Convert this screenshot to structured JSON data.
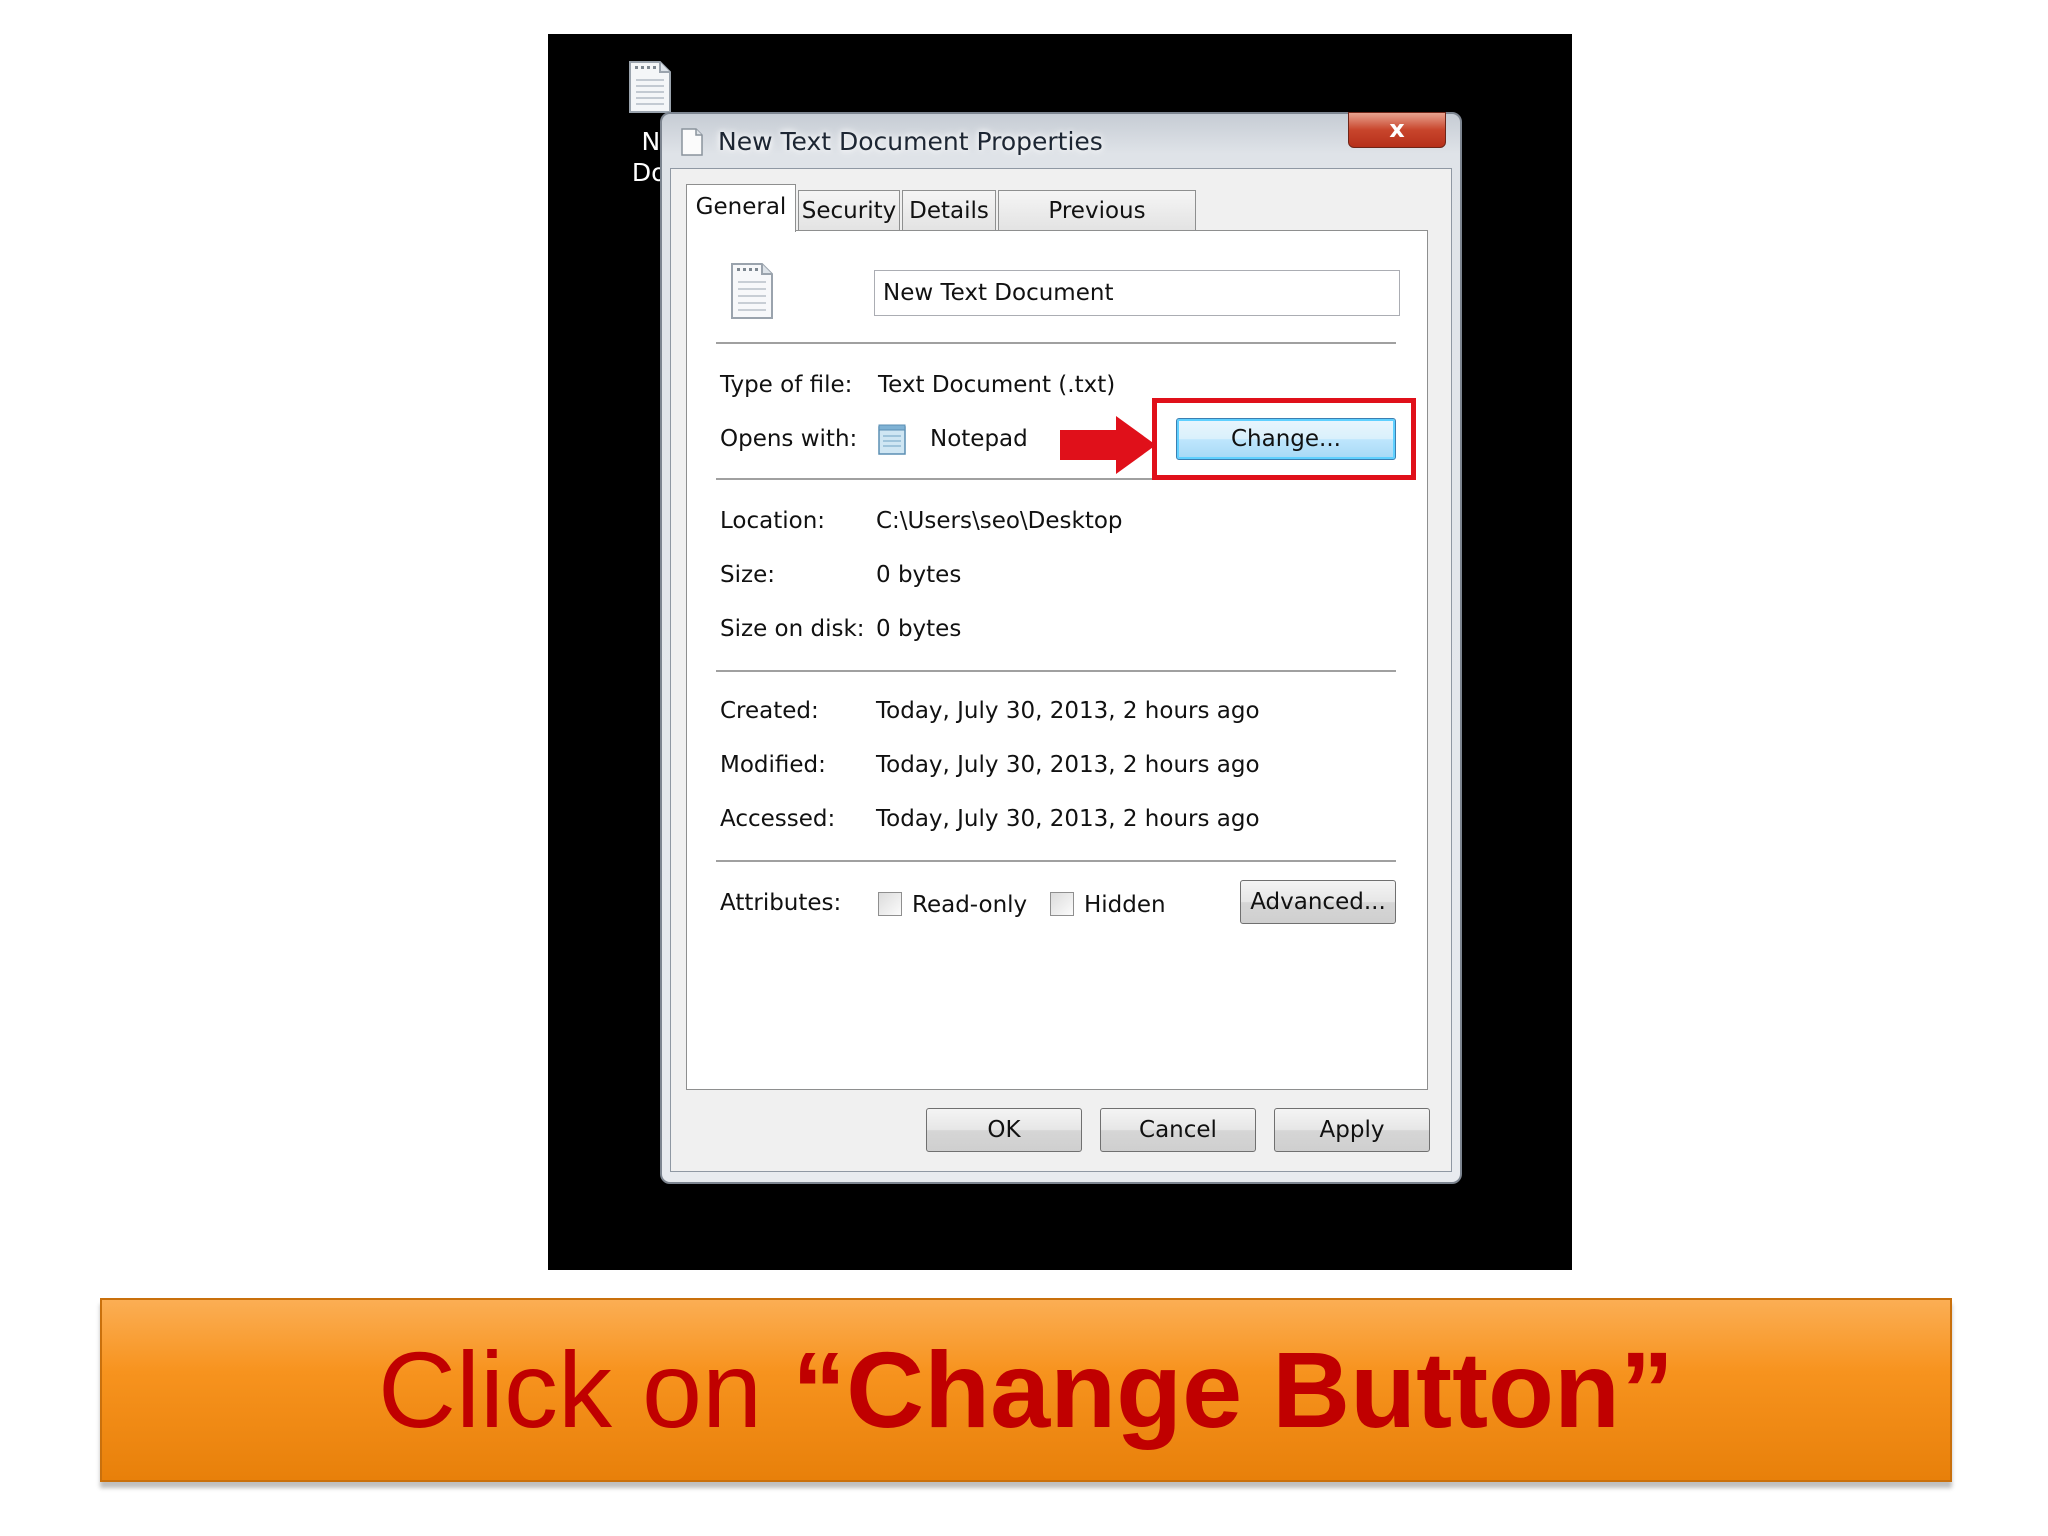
{
  "desktop": {
    "icon_name": "text-file-icon",
    "label": "New\nDocu"
  },
  "window": {
    "title": "New Text Document Properties",
    "close_label": "x",
    "icon_name": "text-file-icon"
  },
  "tabs": [
    {
      "label": "General",
      "active": true
    },
    {
      "label": "Security",
      "active": false
    },
    {
      "label": "Details",
      "active": false
    },
    {
      "label": "Previous Versions",
      "active": false
    }
  ],
  "general": {
    "file_name": "New Text Document",
    "type_label": "Type of file:",
    "type_value": "Text Document (.txt)",
    "opens_label": "Opens with:",
    "opens_value": "Notepad",
    "opens_icon": "notepad-icon",
    "change_label": "Change...",
    "location_label": "Location:",
    "location_value": "C:\\Users\\seo\\Desktop",
    "size_label": "Size:",
    "size_value": "0 bytes",
    "size_disk_label": "Size on disk:",
    "size_disk_value": "0 bytes",
    "created_label": "Created:",
    "created_value": "Today, July 30, 2013, 2 hours ago",
    "modified_label": "Modified:",
    "modified_value": "Today, July 30, 2013, 2 hours ago",
    "accessed_label": "Accessed:",
    "accessed_value": "Today, July 30, 2013, 2 hours ago",
    "attributes_label": "Attributes:",
    "readonly_label": "Read-only",
    "readonly_checked": false,
    "hidden_label": "Hidden",
    "hidden_checked": false,
    "advanced_label": "Advanced..."
  },
  "footer": {
    "ok_label": "OK",
    "cancel_label": "Cancel",
    "apply_label": "Apply"
  },
  "annotation": {
    "highlight_color": "#e0101a",
    "arrow_icon": "red-arrow-right-icon"
  },
  "banner": {
    "prefix": "Click on ",
    "emphasis": "“Change Button”",
    "background": "#f7931e",
    "text_color": "#c00000"
  }
}
